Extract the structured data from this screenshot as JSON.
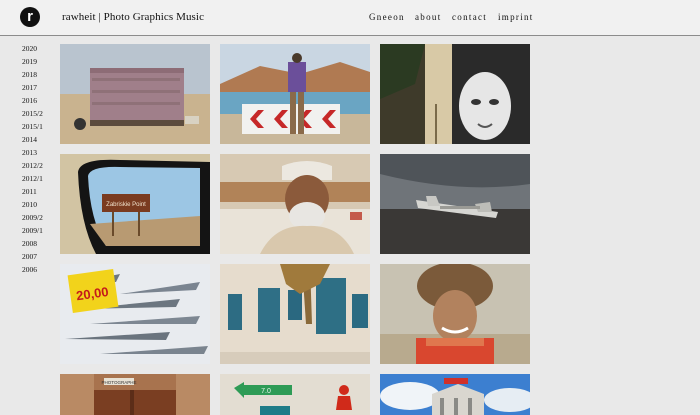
{
  "header": {
    "logo_letter": "r",
    "site_title": "rawheit | Photo Graphics Music",
    "nav": [
      "Gneeon",
      "about",
      "contact",
      "imprint"
    ]
  },
  "sidebar": {
    "years": [
      "2020",
      "2019",
      "2018",
      "2017",
      "2016",
      "2015/2",
      "2015/1",
      "2014",
      "2013",
      "2012/2",
      "2012/1",
      "2011",
      "2010",
      "2009/2",
      "2009/1",
      "2008",
      "2007",
      "2006"
    ]
  },
  "photos": {
    "p1": "container-on-beach-photo",
    "p2": "traveler-at-road-barrier-photo",
    "p3": "mask-street-art-photo",
    "p4_sign": "Zabriskie Point",
    "p5": "elderly-man-portrait-photo",
    "p6": "plane-wreck-photo",
    "p7_price": "20,00",
    "p8": "blue-windows-wall-photo",
    "p9": "woman-fur-hat-portrait-photo",
    "p10_sign": "PHOTOGRAPHE",
    "p11_sign": "7.0",
    "p12": "tower-building-photo"
  }
}
